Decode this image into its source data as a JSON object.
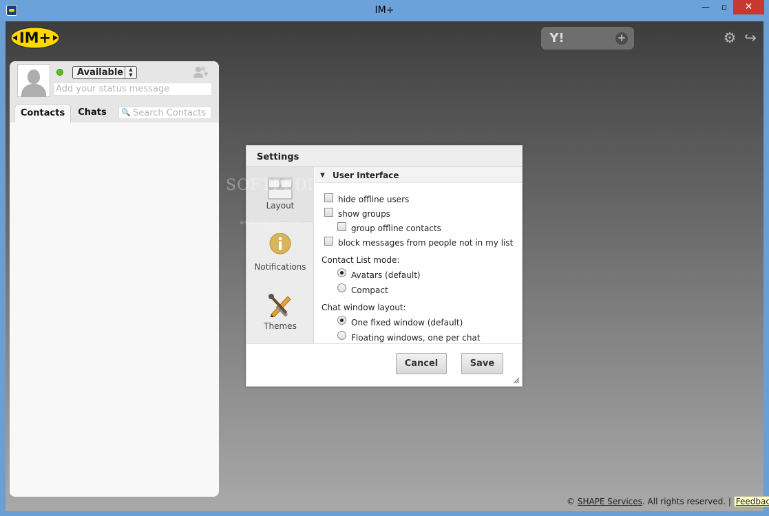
{
  "window": {
    "title": "IM+",
    "minimize": "—",
    "maximize": "▫",
    "close": "✕"
  },
  "topbar": {
    "logo_text": "IM+",
    "account_avatar": "Y!",
    "add_account": "+",
    "settings_icon": "⚙",
    "logout_icon": "↪"
  },
  "profile": {
    "status": "Available",
    "status_placeholder": "Add your status message"
  },
  "tabs": {
    "contacts": "Contacts",
    "chats": "Chats",
    "search_placeholder": "Search Contacts"
  },
  "settings": {
    "title": "Settings",
    "side": {
      "layout": "Layout",
      "notifications": "Notifications",
      "themes": "Themes"
    },
    "section": "User Interface",
    "options": {
      "hide_offline": "hide offline users",
      "show_groups": "show groups",
      "group_offline": "group offline contacts",
      "block_messages": "block messages from people not in my list"
    },
    "contact_list_mode": {
      "label": "Contact List mode:",
      "avatars": "Avatars (default)",
      "compact": "Compact"
    },
    "chat_layout": {
      "label": "Chat window layout:",
      "fixed": "One fixed window (default)",
      "floating": "Floating windows, one per chat"
    },
    "buttons": {
      "cancel": "Cancel",
      "save": "Save"
    }
  },
  "footer": {
    "copyright": "©",
    "company": "SHAPE Services",
    "rights": ". All rights reserved. |",
    "feedback": "Feedback"
  },
  "watermark": {
    "text": "SOFTPEDIA",
    "sub": "www.softpedia.com"
  },
  "colors": {
    "titlebar": "#6ba2d9",
    "status_online": "#57c21a",
    "logo_yellow": "#ffd800",
    "close_red": "#c7382e"
  }
}
